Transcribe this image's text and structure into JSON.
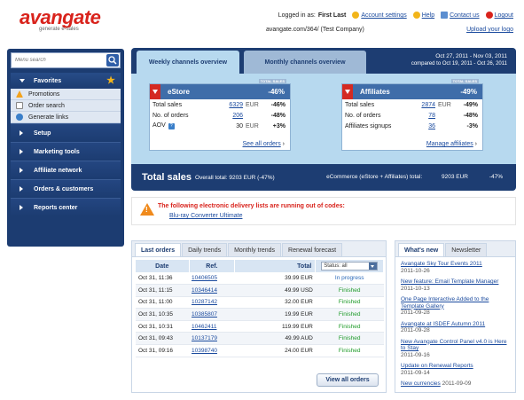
{
  "header": {
    "logo_brand": "avangate",
    "logo_tagline": "generate e-sales",
    "logged_in_label": "Logged in as:",
    "user_name": "First Last",
    "account_settings": "Account settings",
    "help": "Help",
    "contact_us": "Contact us",
    "logout": "Logout",
    "account_path": "avangate.com/364/ (Test Company)",
    "upload_logo": "Upload your logo"
  },
  "sidebar": {
    "search_placeholder": "Menu search",
    "favorites_label": "Favorites",
    "favorites": [
      {
        "label": "Promotions",
        "icon": "promotions-icon"
      },
      {
        "label": "Order search",
        "icon": "order-search-icon"
      },
      {
        "label": "Generate links",
        "icon": "generate-links-icon"
      }
    ],
    "sections": [
      "Setup",
      "Marketing tools",
      "Affiliate network",
      "Orders & customers",
      "Reports center"
    ]
  },
  "overview": {
    "tabs": [
      "Weekly channels overview",
      "Monthly channels overview"
    ],
    "date_range": "Oct 27, 2011 - Nov 03, 2011",
    "compare_range": "compared to Oct 19, 2011 - Oct 26, 2011",
    "total_badge": "TOTAL SALES",
    "estore": {
      "title": "eStore",
      "pct": "-46%",
      "rows": [
        {
          "label": "Total sales",
          "value": "6329",
          "unit": "EUR",
          "pct": "-46%",
          "link": true
        },
        {
          "label": "No. of orders",
          "value": "206",
          "unit": "",
          "pct": "-48%",
          "link": true
        },
        {
          "label": "AOV",
          "value": "30",
          "unit": "EUR",
          "pct": "+3%",
          "link": false
        }
      ],
      "footer": "See all orders"
    },
    "affiliates": {
      "title": "Affiliates",
      "pct": "-49%",
      "rows": [
        {
          "label": "Total sales",
          "value": "2874",
          "unit": "EUR",
          "pct": "-49%",
          "link": true
        },
        {
          "label": "No. of orders",
          "value": "78",
          "unit": "",
          "pct": "-48%",
          "link": true
        },
        {
          "label": "Affiliates signups",
          "value": "36",
          "unit": "",
          "pct": "-3%",
          "link": true
        }
      ],
      "footer": "Manage affiliates"
    },
    "total_sales_title": "Total sales",
    "overall_total": "Overall total: 9203 EUR (-47%)",
    "ecommerce_label": "eCommerce (eStore + Affiliates) total:",
    "ecommerce_value": "9203 EUR",
    "ecommerce_pct": "-47%"
  },
  "warning": {
    "message": "The following electronic delivery lists are running out of codes:",
    "link": "Blu-ray Converter Ultimate"
  },
  "orders": {
    "tabs": [
      "Last orders",
      "Daily trends",
      "Monthly trends",
      "Renewal forecast"
    ],
    "columns": {
      "date": "Date",
      "ref": "Ref.",
      "total": "Total",
      "status_filter": "Status: all"
    },
    "rows": [
      {
        "date": "Oct 31, 11:36",
        "ref": "10406505",
        "total": "39.99 EUR",
        "status": "In progress"
      },
      {
        "date": "Oct 31, 11:15",
        "ref": "10346414",
        "total": "49.99 USD",
        "status": "Finished"
      },
      {
        "date": "Oct 31, 11:00",
        "ref": "10287142",
        "total": "32.00 EUR",
        "status": "Finished"
      },
      {
        "date": "Oct 31, 10:35",
        "ref": "10385807",
        "total": "19.99 EUR",
        "status": "Finished"
      },
      {
        "date": "Oct 31, 10:31",
        "ref": "10462411",
        "total": "119.99 EUR",
        "status": "Finished"
      },
      {
        "date": "Oct 31, 09:43",
        "ref": "10137179",
        "total": "49.99 AUD",
        "status": "Finished"
      },
      {
        "date": "Oct 31, 09:16",
        "ref": "10398740",
        "total": "24.00 EUR",
        "status": "Finished"
      }
    ],
    "view_all": "View all orders"
  },
  "news": {
    "tabs": [
      "What's new",
      "Newsletter"
    ],
    "items": [
      {
        "title": "Avangate Sky Tour Events 2011",
        "date": "2011-10-26"
      },
      {
        "title": "New feature: Email Template Manager",
        "date": "2011-10-13"
      },
      {
        "title": "One Page Interactive Added to the Template Gallery",
        "date": "2011-09-28"
      },
      {
        "title": "Avangate at ISDEF Autumn 2011",
        "date": "2011-09-28"
      },
      {
        "title": "New Avangate Control Panel v4.0 is Here to Stay",
        "date": "2011-09-16"
      },
      {
        "title": "Update on Renewal Reports",
        "date": "2011-09-14"
      },
      {
        "title": "New currencies",
        "date": "2011-09-09"
      }
    ]
  },
  "colors": {
    "brand_red": "#d9231c",
    "nav_blue": "#1d3d72",
    "finished_green": "#1f9b2a",
    "progress_blue": "#2968b8"
  }
}
